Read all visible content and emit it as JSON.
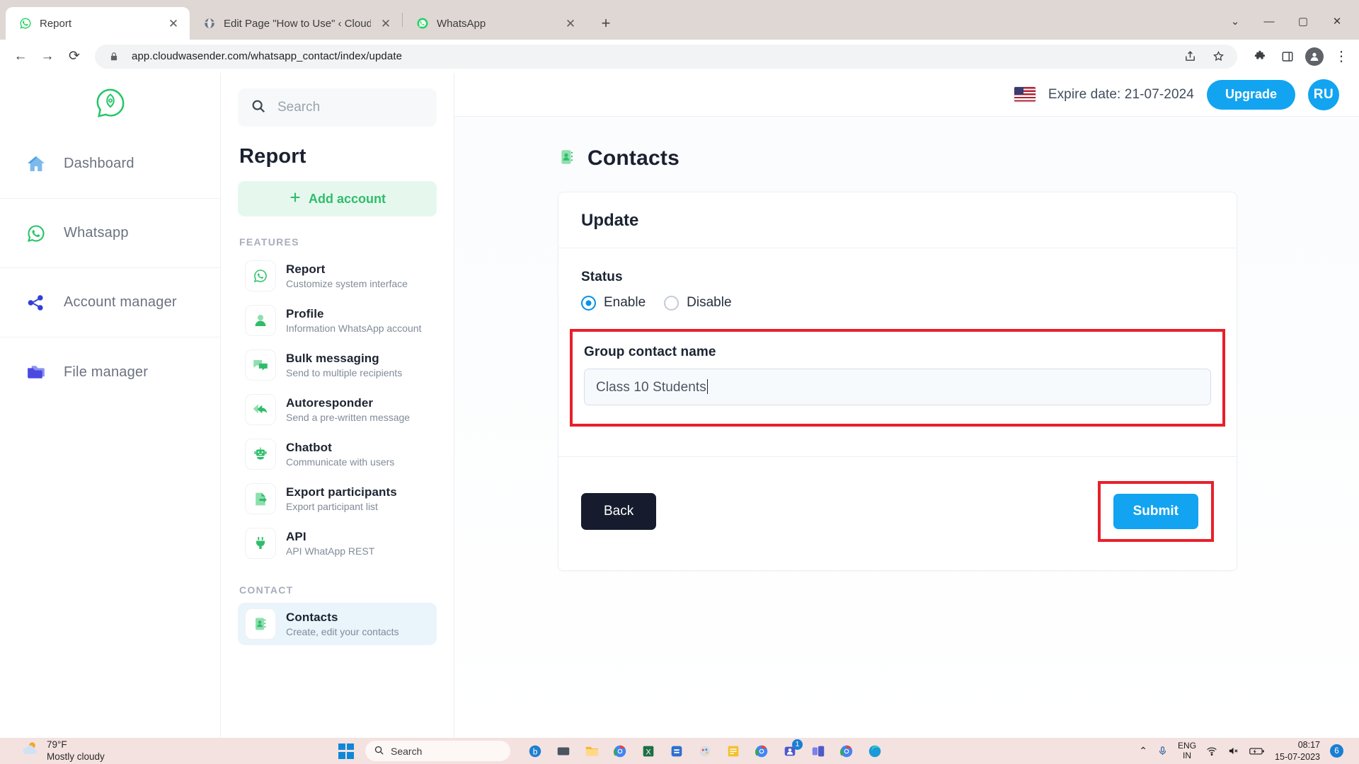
{
  "browser": {
    "tabs": [
      {
        "title": "Report",
        "favicon": "whatsapp-icon",
        "active": true,
        "close_label": "✕"
      },
      {
        "title": "Edit Page \"How to Use\" ‹ Cloud W",
        "favicon": "globe-icon",
        "active": false,
        "close_label": "✕"
      },
      {
        "title": "WhatsApp",
        "favicon": "whatsapp-icon",
        "active": false,
        "close_label": "✕"
      }
    ],
    "newtab_label": "+",
    "window_controls": {
      "chevron": "⌄",
      "minimize": "—",
      "maximize": "▢",
      "close": "✕"
    },
    "toolbar": {
      "back": "←",
      "forward": "→",
      "reload": "⟳",
      "url": "app.cloudwasender.com/whatsapp_contact/index/update",
      "lock": "lock-icon",
      "share": "share-icon",
      "bookmark": "star-icon",
      "extensions": "puzzle-icon",
      "sidepanel": "sidepanel-icon",
      "profile": "profile-icon",
      "menu": "⋮"
    }
  },
  "rail": {
    "logo": "rocket-whatsapp-logo",
    "items": [
      {
        "label": "Dashboard",
        "icon": "home-icon"
      },
      {
        "label": "Whatsapp",
        "icon": "whatsapp-icon"
      },
      {
        "label": "Account manager",
        "icon": "share-nodes-icon"
      },
      {
        "label": "File manager",
        "icon": "folder-icon"
      }
    ]
  },
  "panel": {
    "search_placeholder": "Search",
    "search_icon": "search-icon",
    "title": "Report",
    "add_account_label": "Add account",
    "add_account_icon": "plus-icon",
    "features_label": "FEATURES",
    "contact_label": "CONTACT",
    "features": [
      {
        "title": "Report",
        "subtitle": "Customize system interface",
        "icon": "whatsapp-icon"
      },
      {
        "title": "Profile",
        "subtitle": "Information WhatsApp account",
        "icon": "user-icon"
      },
      {
        "title": "Bulk messaging",
        "subtitle": "Send to multiple recipients",
        "icon": "chat-bubbles-icon"
      },
      {
        "title": "Autoresponder",
        "subtitle": "Send a pre-written message",
        "icon": "reply-arrow-icon"
      },
      {
        "title": "Chatbot",
        "subtitle": "Communicate with users",
        "icon": "robot-icon"
      },
      {
        "title": "Export participants",
        "subtitle": "Export participant list",
        "icon": "file-export-icon"
      },
      {
        "title": "API",
        "subtitle": "API WhatApp REST",
        "icon": "plug-icon"
      }
    ],
    "contacts": [
      {
        "title": "Contacts",
        "subtitle": "Create, edit your contacts",
        "icon": "contact-book-icon",
        "active": true
      }
    ]
  },
  "topbar": {
    "flag": "us-flag-icon",
    "expire_text": "Expire date: 21-07-2024",
    "upgrade_label": "Upgrade",
    "avatar_initials": "RU"
  },
  "main": {
    "page_title": "Contacts",
    "page_icon": "contact-book-icon",
    "card_heading": "Update",
    "status_label": "Status",
    "status_options": [
      {
        "label": "Enable",
        "checked": true
      },
      {
        "label": "Disable",
        "checked": false
      }
    ],
    "group_name_label": "Group contact name",
    "group_name_value": "Class 10 Students",
    "back_label": "Back",
    "submit_label": "Submit"
  },
  "colors": {
    "accent_blue": "#12a4f0",
    "whatsapp_green": "#2fbd6b",
    "highlight_red": "#e8202a",
    "dark_button": "#161c2d"
  },
  "taskbar": {
    "weather_temp": "79°F",
    "weather_desc": "Mostly cloudy",
    "search_placeholder": "Search",
    "search_icon": "search-icon",
    "start_icon": "windows-logo",
    "apps": [
      {
        "name": "copilot-icon",
        "badge": ""
      },
      {
        "name": "taskview-icon",
        "badge": ""
      },
      {
        "name": "file-explorer-icon",
        "badge": ""
      },
      {
        "name": "chrome-icon",
        "badge": ""
      },
      {
        "name": "excel-icon",
        "badge": ""
      },
      {
        "name": "store-icon",
        "badge": ""
      },
      {
        "name": "paint-icon",
        "badge": ""
      },
      {
        "name": "notes-icon",
        "badge": ""
      },
      {
        "name": "chrome2-icon",
        "badge": ""
      },
      {
        "name": "teams-icon",
        "badge": "1"
      },
      {
        "name": "teams2-icon",
        "badge": ""
      },
      {
        "name": "chrome3-icon",
        "badge": ""
      },
      {
        "name": "edge-icon",
        "badge": ""
      }
    ],
    "tray": {
      "chevron": "⌃",
      "mic": "mic-icon",
      "lang_line1": "ENG",
      "lang_line2": "IN",
      "wifi": "wifi-icon",
      "volume": "volume-mute-icon",
      "battery": "battery-charging-icon",
      "time": "08:17",
      "date": "15-07-2023",
      "notification_count": "6"
    }
  }
}
